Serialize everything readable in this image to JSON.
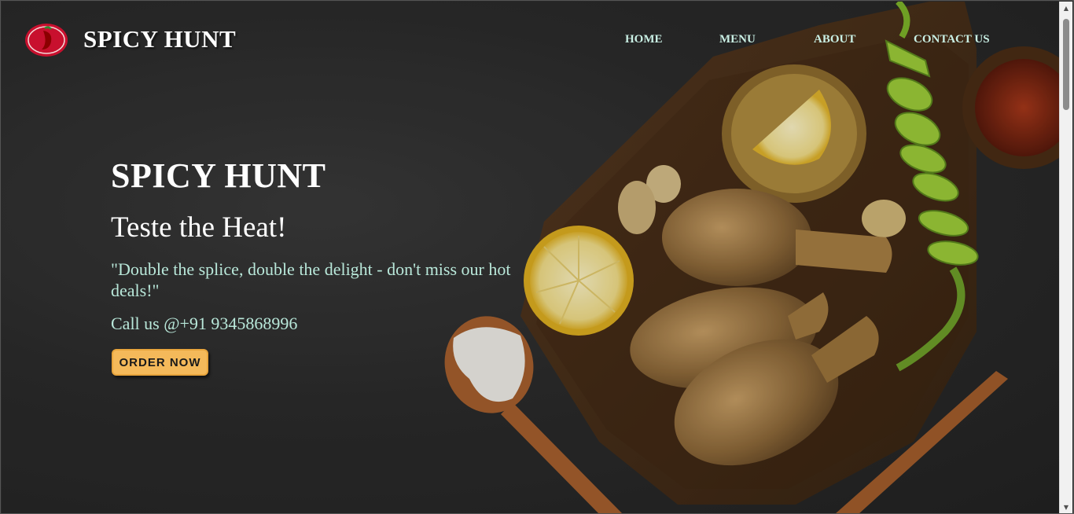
{
  "header": {
    "brand": "SPICY HUNT",
    "logo_icon": "chili-pepper-logo-icon",
    "nav": [
      {
        "label": "HOME"
      },
      {
        "label": "MENU"
      },
      {
        "label": "ABOUT"
      },
      {
        "label": "CONTACT US"
      }
    ]
  },
  "hero": {
    "title": "SPICY HUNT",
    "subtitle": "Teste the Heat!",
    "quote": "\"Double the splice, double the delight - don't miss our hot deals!\"",
    "call": "Call us @+91 9345868996",
    "order_label": "ORDER NOW"
  },
  "colors": {
    "accent_button": "#f4b95a",
    "nav_text": "#c9efe4",
    "body_text": "#b9e8da",
    "logo_red": "#c8102e"
  }
}
